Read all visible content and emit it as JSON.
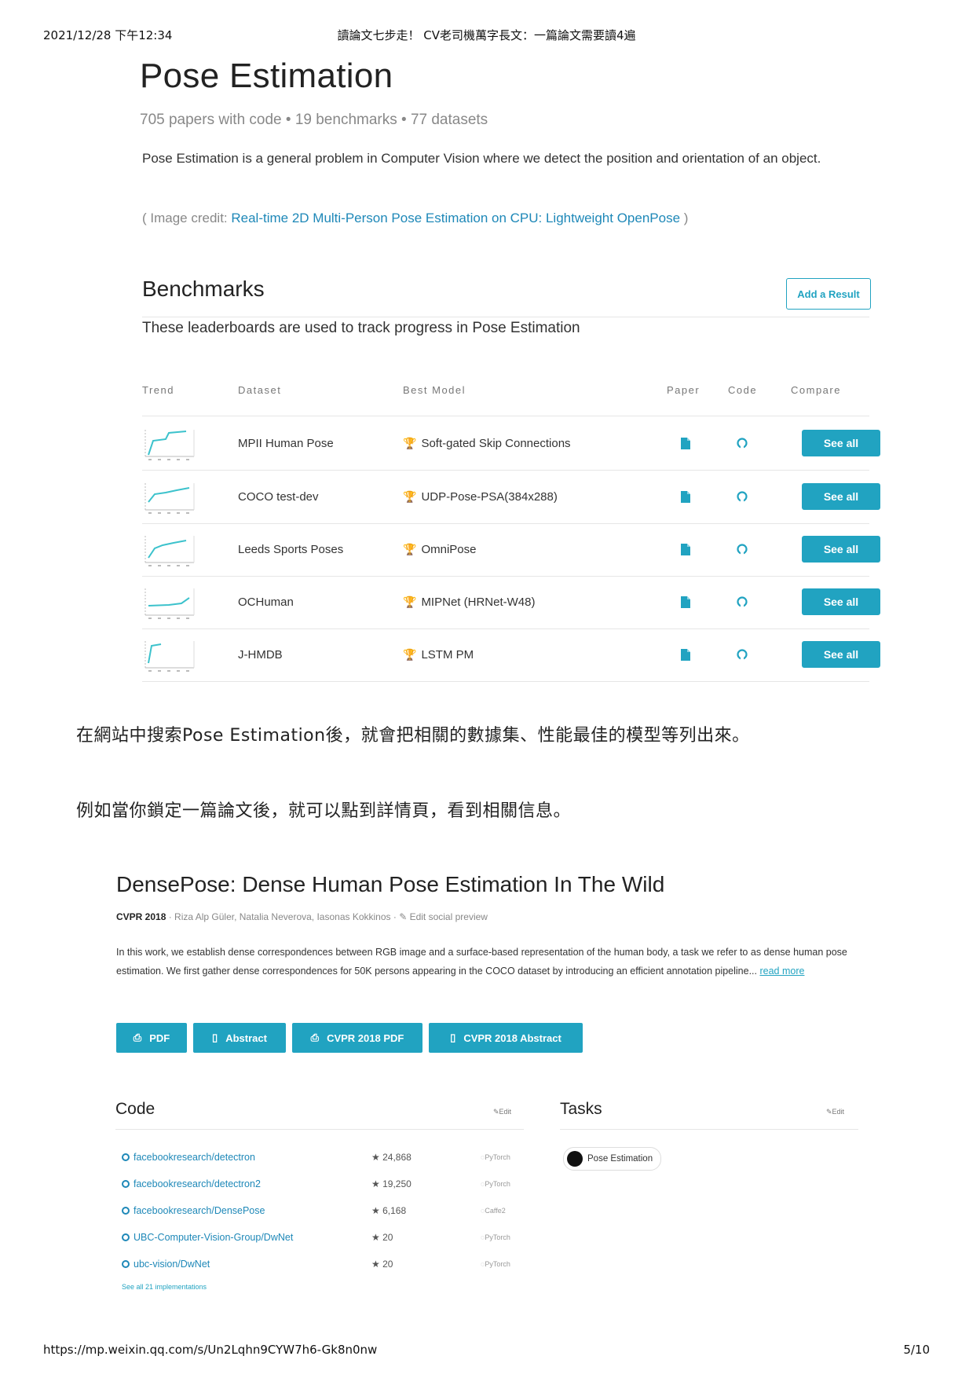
{
  "header": {
    "left": "2021/12/28 下午12:34",
    "center": "讀論文七步走！ CV老司機萬字長文：一篇論文需要讀4遍"
  },
  "footer": {
    "url": "https://mp.weixin.qq.com/s/Un2Lqhn9CYW7h6-Gk8n0nw",
    "page": "5/10"
  },
  "pose": {
    "title": "Pose Estimation",
    "stats": "705 papers with code • 19 benchmarks • 77 datasets",
    "description": "Pose Estimation is a general problem in Computer Vision where we detect the position and orientation of an object.",
    "credit_prefix": "( Image credit: ",
    "credit_link": "Real-time 2D Multi-Person Pose Estimation on CPU: Lightweight OpenPose",
    "credit_suffix": " )",
    "benchmarks_title": "Benchmarks",
    "benchmarks_sub": "These leaderboards are used to track progress in Pose Estimation",
    "add_result": "Add a Result",
    "columns": {
      "trend": "Trend",
      "dataset": "Dataset",
      "best_model": "Best Model",
      "paper": "Paper",
      "code": "Code",
      "compare": "Compare"
    },
    "rows": [
      {
        "dataset": "MPII Human Pose",
        "model": "Soft-gated Skip Connections",
        "compare": "See all"
      },
      {
        "dataset": "COCO test-dev",
        "model": "UDP-Pose-PSA(384x288)",
        "compare": "See all"
      },
      {
        "dataset": "Leeds Sports Poses",
        "model": "OmniPose",
        "compare": "See all"
      },
      {
        "dataset": "OCHuman",
        "model": "MIPNet (HRNet-W48)",
        "compare": "See all"
      },
      {
        "dataset": "J-HMDB",
        "model": "LSTM PM",
        "compare": "See all"
      }
    ]
  },
  "zh_line1": "在網站中搜索Pose Estimation後，就會把相關的數據集、性能最佳的模型等列出來。",
  "zh_line2": "例如當你鎖定一篇論文後，就可以點到詳情頁，看到相關信息。",
  "densepose": {
    "title": "DensePose: Dense Human Pose Estimation In The Wild",
    "venue": "CVPR 2018",
    "authors": " · Riza Alp Güler, Natalia Neverova, Iasonas Kokkinos · ",
    "edit_preview": "Edit social preview",
    "abstract": "In this work, we establish dense correspondences between RGB image and a surface-based representation of the human body, a task we refer to as dense human pose estimation. We first gather dense correspondences for 50K persons appearing in the COCO dataset by introducing an efficient annotation pipeline... ",
    "read_more": "read more",
    "buttons": [
      "PDF",
      "Abstract",
      "CVPR 2018 PDF",
      "CVPR 2018 Abstract"
    ],
    "code_title": "Code",
    "tasks_title": "Tasks",
    "edit": "Edit",
    "repos": [
      {
        "name": "facebookresearch/detectron",
        "stars": "24,868",
        "framework": "PyTorch"
      },
      {
        "name": "facebookresearch/detectron2",
        "stars": "19,250",
        "framework": "PyTorch"
      },
      {
        "name": "facebookresearch/DensePose",
        "stars": "6,168",
        "framework": "Caffe2"
      },
      {
        "name": "UBC-Computer-Vision-Group/DwNet",
        "stars": "20",
        "framework": "PyTorch"
      },
      {
        "name": "ubc-vision/DwNet",
        "stars": "20",
        "framework": "PyTorch"
      }
    ],
    "see_all": "See all 21 implementations",
    "task": "Pose Estimation"
  },
  "colors": {
    "accent": "#21a3c1",
    "link": "#1e88b8",
    "trophy": "#e6a817"
  }
}
